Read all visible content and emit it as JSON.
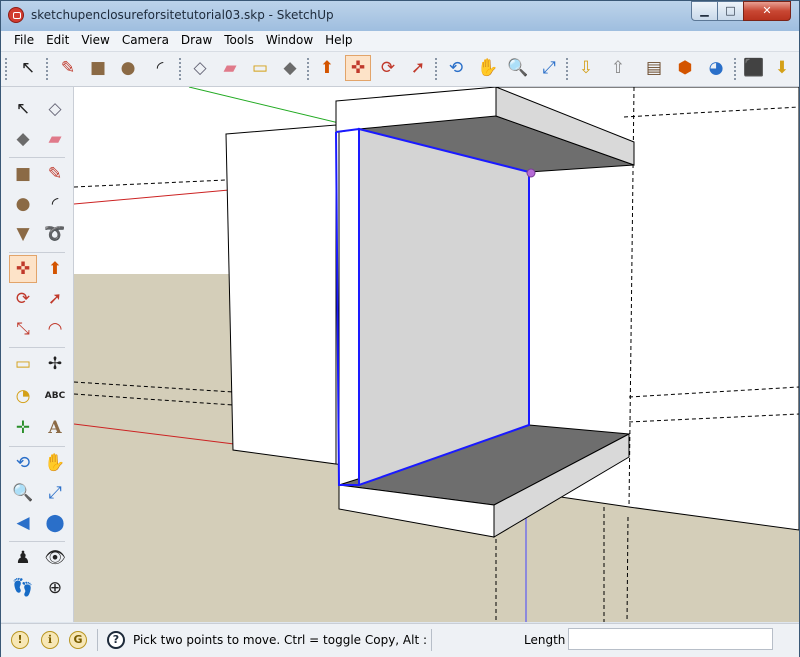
{
  "window": {
    "title": "sketchupenclosureforsitetutorial03.skp - SketchUp",
    "min_glyph": "▁",
    "max_glyph": "□",
    "close_glyph": "✕"
  },
  "menu": [
    "File",
    "Edit",
    "View",
    "Camera",
    "Draw",
    "Tools",
    "Window",
    "Help"
  ],
  "toolbar": {
    "select": "↖",
    "pencil": "✎",
    "rectangle": "■",
    "circle": "●",
    "arc": "◜",
    "make_component": "◇",
    "eraser": "▰",
    "tape_measure": "▭",
    "paint_bucket": "◆",
    "push_pull": "⬆",
    "move": "✜",
    "rotate": "⟳",
    "follow_me": "➚",
    "orbit": "⟲",
    "pan": "✋",
    "zoom": "🔍",
    "zoom_extents": "⤢",
    "get_models": "⇩",
    "share_model": "⇧",
    "components": "▤",
    "photo_textures": "⬢",
    "google_earth": "◕",
    "extension_a": "⬛",
    "extension_b": "⬇"
  },
  "left_tools": {
    "select": "↖",
    "make_component": "◇",
    "paint_bucket": "◆",
    "eraser": "▰",
    "rectangle": "■",
    "line": "✎",
    "circle": "●",
    "arc": "◜",
    "polygon": "▼",
    "freehand": "➰",
    "move": "✜",
    "push_pull": "⬆",
    "rotate": "⟳",
    "follow_me": "➚",
    "scale": "⤡",
    "offset": "◠",
    "tape_measure": "▭",
    "dimension": "✢",
    "protractor": "◔",
    "text": "ABC",
    "axes": "✛",
    "text_3d": "A",
    "orbit": "⟲",
    "pan": "✋",
    "zoom": "🔍",
    "zoom_window": "⤢",
    "previous": "◀",
    "zoom_extents": "⬤",
    "position_camera": "♟",
    "look_around": "👁",
    "walk": "👣",
    "section_plane": "⊕"
  },
  "status": {
    "icons": [
      "!",
      "ℹ",
      "G"
    ],
    "help_glyph": "?",
    "message": "Pick two points to move.  Ctrl = toggle Copy, Alt :",
    "length_label": "Length",
    "length_value": ""
  },
  "colors": {
    "sky": "#ffffff",
    "ground": "#d4ceb9",
    "selection": "#1a1aff",
    "face_front": "#d4d4d4",
    "face_shadow": "#6e6e6e",
    "face_white": "#ffffff",
    "axis_red": "#cc2222",
    "axis_green": "#22aa22",
    "axis_blue": "#4444ff"
  }
}
